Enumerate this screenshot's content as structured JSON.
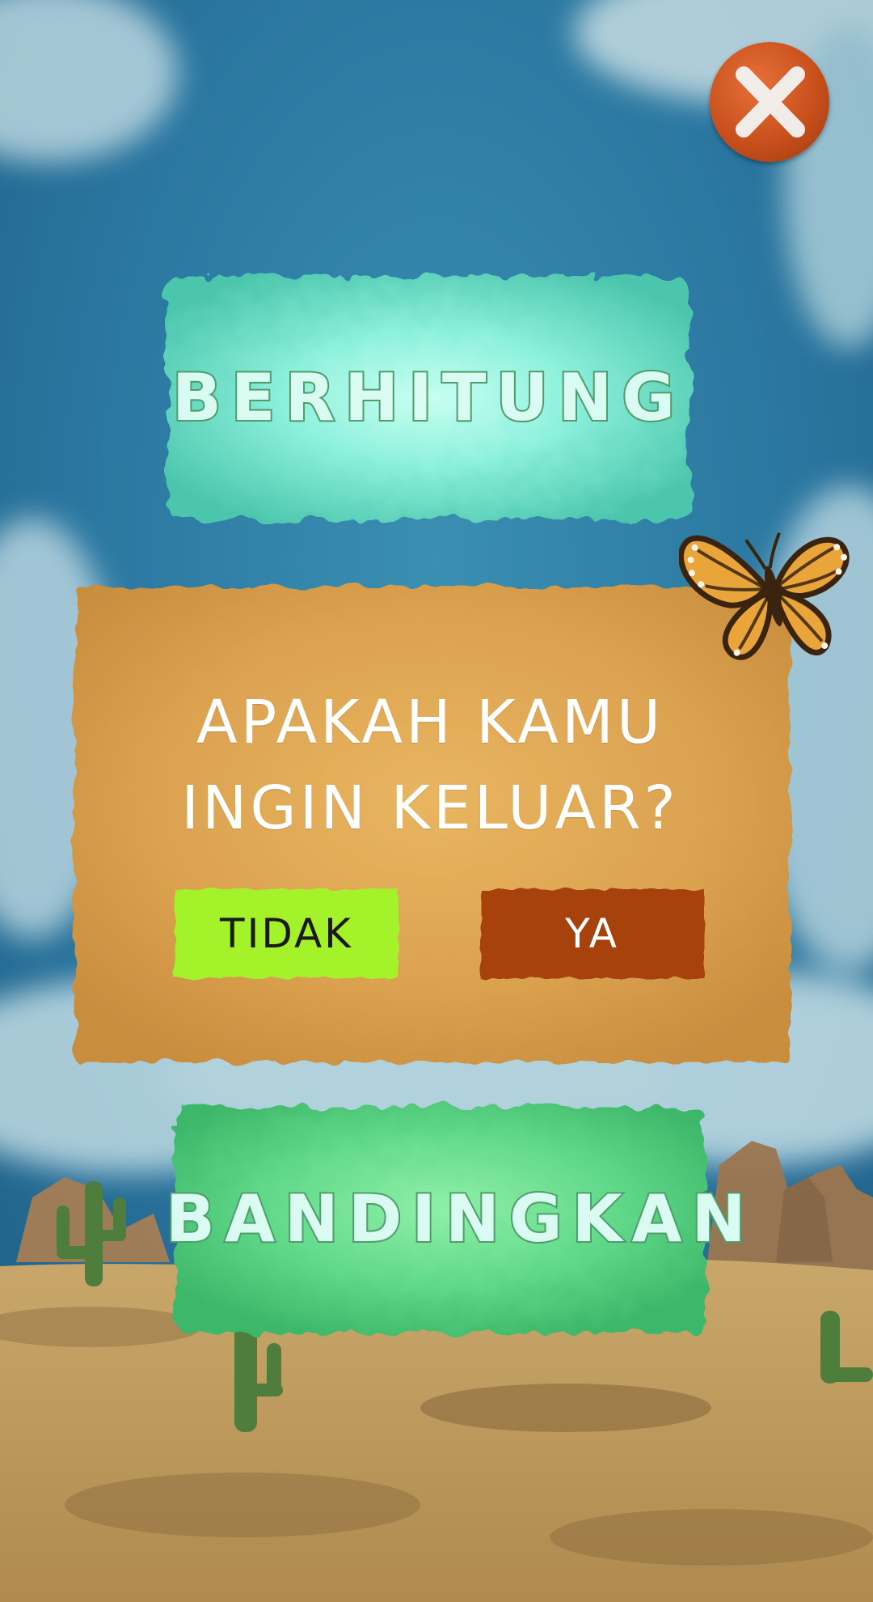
{
  "app": {
    "close_icon": "close-x-icon"
  },
  "menu": {
    "items": [
      {
        "label": "BERHITUNG"
      },
      {
        "label": "BANDINGKAN"
      }
    ]
  },
  "dialog": {
    "question_line1": "APAKAH KAMU",
    "question_line2": "INGIN KELUAR?",
    "no_label": "TIDAK",
    "yes_label": "YA"
  },
  "colors": {
    "sky": "#2f7fa6",
    "dialog_board": "#dba250",
    "no_button": "#a4f22a",
    "yes_button": "#a84308",
    "menu_panel_top": "#6fe9cf",
    "menu_panel_bottom": "#62d98a",
    "close_button": "#c9501c"
  }
}
